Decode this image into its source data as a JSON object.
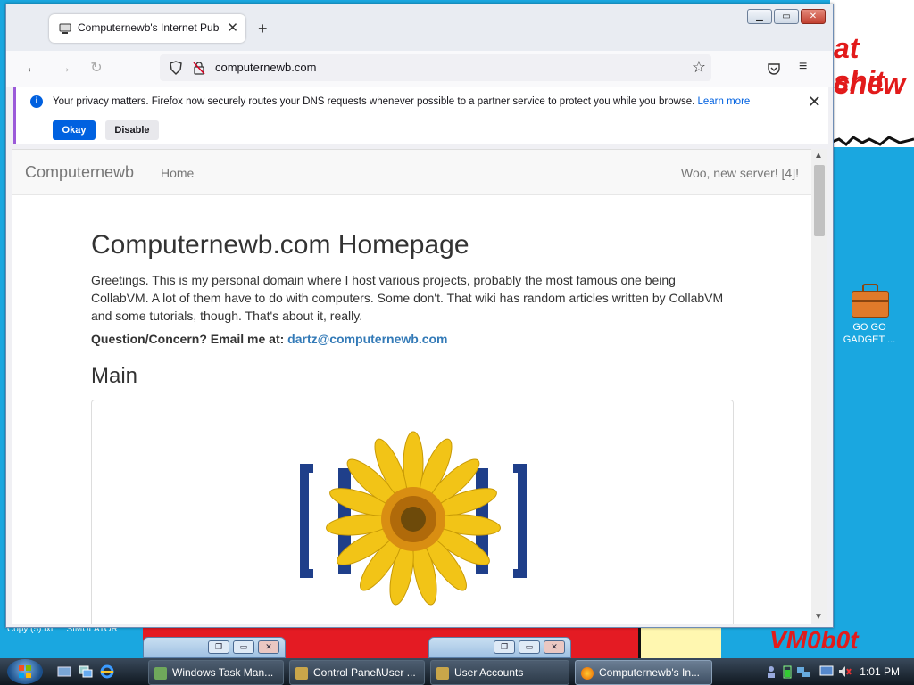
{
  "wallpaper": {
    "text_line1": "at shit",
    "text_line2": "chew",
    "corner_text": "VM0b0t"
  },
  "desktop": {
    "icon_label": "GO GO GADGET ...",
    "file_labels": [
      "Copy (5).txt",
      "SIMULATOR"
    ]
  },
  "browser": {
    "tab_title": "Computernewb's Internet Pub H",
    "url": "computernewb.com",
    "notification": {
      "message": "Your privacy matters. Firefox now securely routes your DNS requests whenever possible to a partner service to protect you while you browse.",
      "learn_more": "Learn more",
      "okay_label": "Okay",
      "disable_label": "Disable"
    }
  },
  "site": {
    "brand": "Computernewb",
    "nav_home": "Home",
    "nav_right": "Woo, new server! [4]!",
    "title": "Computernewb.com Homepage",
    "intro": "Greetings. This is my personal domain where I host various projects, probably the most famous one being CollabVM. A lot of them have to do with computers. Some don't. That wiki has random articles written by CollabVM and some tutorials, though. That's about it, really.",
    "question_label": "Question/Concern? Email me at:",
    "email": "dartz@computernewb.com",
    "section_main": "Main"
  },
  "taskbar": {
    "items": [
      {
        "label": "Windows Task Man...",
        "icon": "task-manager-icon"
      },
      {
        "label": "Control Panel\\User ...",
        "icon": "control-panel-icon"
      },
      {
        "label": "User Accounts",
        "icon": "user-accounts-icon"
      },
      {
        "label": "Computernewb's In...",
        "icon": "firefox-icon"
      }
    ],
    "clock": "1:01 PM"
  },
  "colors": {
    "desktop_bg": "#1aa7e0",
    "accent_blue": "#0061e0",
    "wallpaper_red": "#e41b23",
    "link_blue": "#337ab7"
  }
}
